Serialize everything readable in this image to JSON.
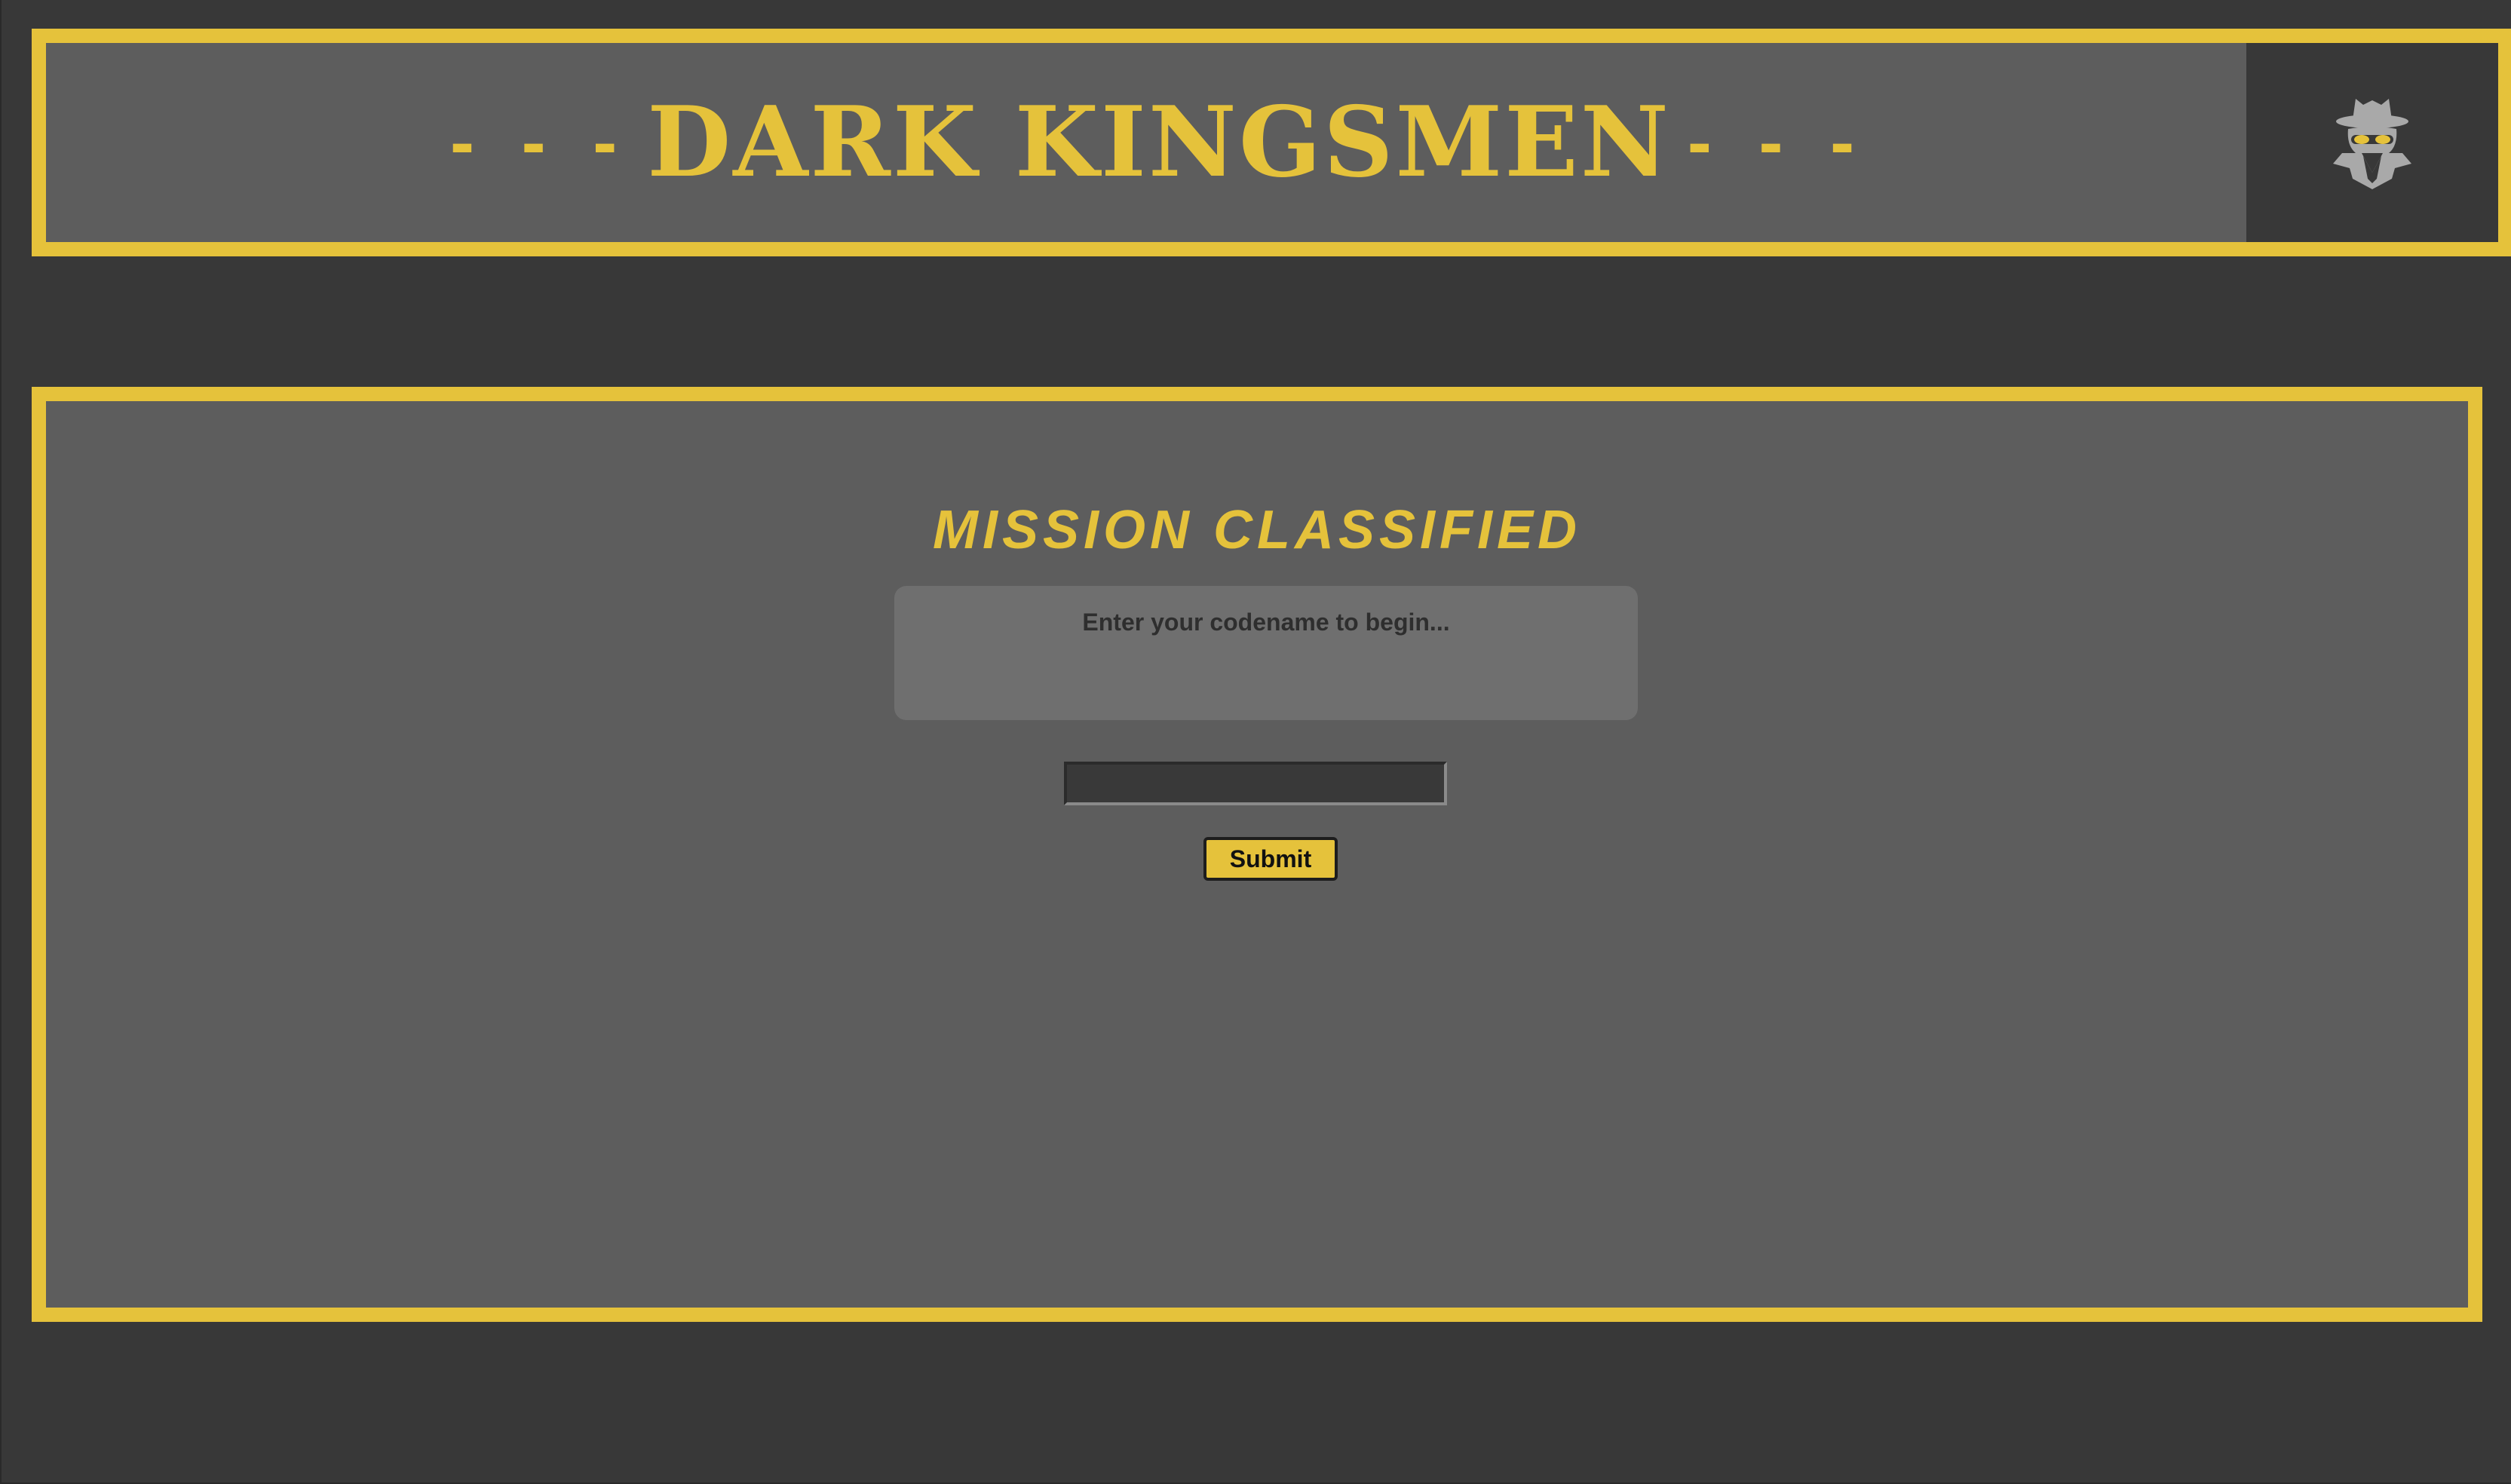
{
  "colors": {
    "accent": "#e5c23b",
    "panel": "#5d5d5d",
    "background": "#383838",
    "prompt_box": "#6f6f6f",
    "spy_icon": "#a9a9a9"
  },
  "header": {
    "dashes_left": "- - -",
    "title": "DARK KINGSMEN",
    "dashes_right": "- - -",
    "icon": "spy-icon"
  },
  "mission": {
    "title": "MISSION CLASSIFIED",
    "prompt": "Enter your codename to begin...",
    "codename_value": "",
    "submit_label": "Submit"
  }
}
